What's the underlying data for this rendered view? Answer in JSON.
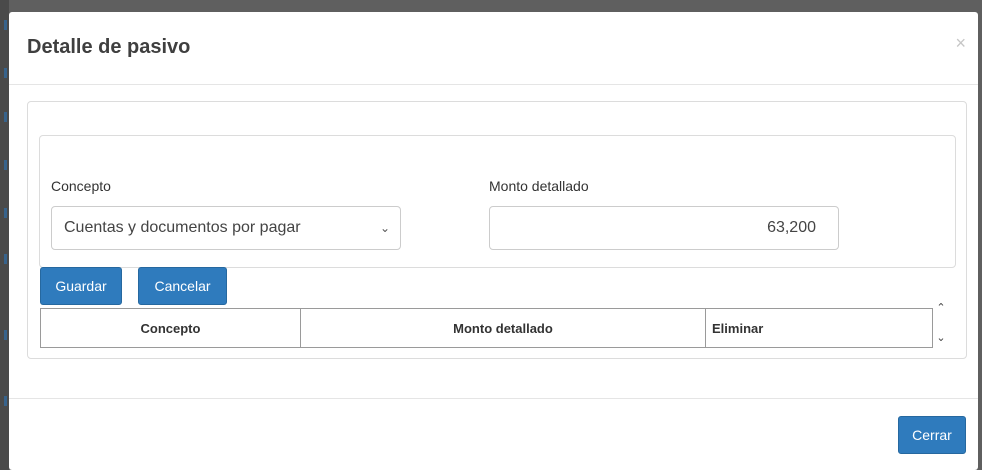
{
  "modal": {
    "title": "Detalle de pasivo",
    "close_glyph": "×"
  },
  "form": {
    "concepto_label": "Concepto",
    "concepto_selected": "Cuentas y documentos por pagar",
    "monto_label": "Monto detallado",
    "monto_value": "63,200"
  },
  "actions": {
    "save_label": "Guardar",
    "cancel_label": "Cancelar"
  },
  "table": {
    "headers": [
      "Concepto",
      "Monto detallado",
      "Eliminar"
    ]
  },
  "footer": {
    "close_label": "Cerrar"
  },
  "icons": {
    "select_chevron": "chevron-down-icon",
    "scroll_up": "scroll-up-icon",
    "scroll_down": "scroll-down-icon"
  },
  "colors": {
    "primary": "#2f7bbd",
    "backdrop": "#5f5f5f"
  }
}
